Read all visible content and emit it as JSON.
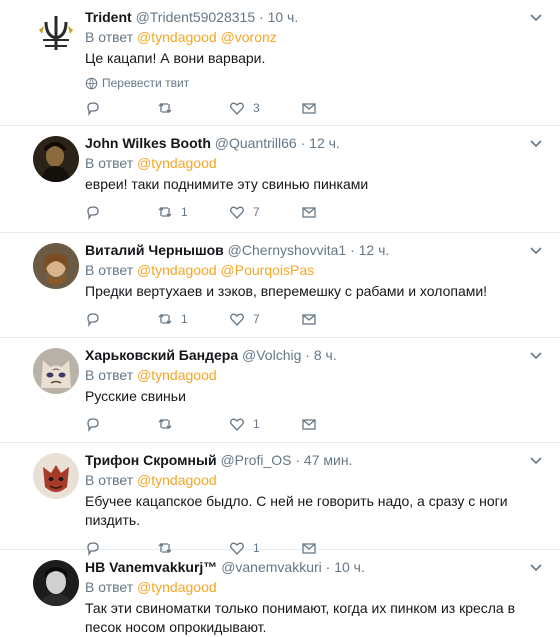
{
  "reply_prefix": "В ответ",
  "translate_label": "Перевести твит",
  "tweets": [
    {
      "name": "Trident",
      "handle": "@Trident59028315",
      "time": "10 ч.",
      "mentions": [
        "@tyndagood",
        "@voronz"
      ],
      "text": "Це кацапи! А вони варвари.",
      "show_translate": true,
      "retweets": "",
      "likes": "3"
    },
    {
      "name": "John Wilkes Booth",
      "handle": "@Quantrill66",
      "time": "12 ч.",
      "mentions": [
        "@tyndagood"
      ],
      "text": "евреи! таки поднимите эту свинью пинками",
      "show_translate": false,
      "retweets": "1",
      "likes": "7"
    },
    {
      "name": "Виталий Чернышов",
      "handle": "@Chernyshovvita1",
      "time": "12 ч.",
      "mentions": [
        "@tyndagood",
        "@PourqoisPas"
      ],
      "text": "Предки вертухаев и зэков, вперемешку с рабами и холопами!",
      "show_translate": false,
      "retweets": "1",
      "likes": "7"
    },
    {
      "name": "Харьковский Бандера",
      "handle": "@Volchig",
      "time": "8 ч.",
      "mentions": [
        "@tyndagood"
      ],
      "text": "Русские свиньи",
      "show_translate": false,
      "retweets": "",
      "likes": "1"
    },
    {
      "name": "Трифон Скромный",
      "handle": "@Profi_OS",
      "time": "47 мин.",
      "mentions": [
        "@tyndagood"
      ],
      "text": "Ебучее кацапское быдло. С ней не говорить надо, а сразу с ноги пиздить.",
      "show_translate": false,
      "retweets": "",
      "likes": "1"
    },
    {
      "name": "HB Vanemvakkurj™",
      "handle": "@vanemvakkuri",
      "time": "10 ч.",
      "mentions": [
        "@tyndagood"
      ],
      "text": "Так эти свиноматки только понимают, когда их пинком из кресла в песок носом опрокидывают.",
      "show_translate": false,
      "retweets": "",
      "likes": ""
    }
  ]
}
